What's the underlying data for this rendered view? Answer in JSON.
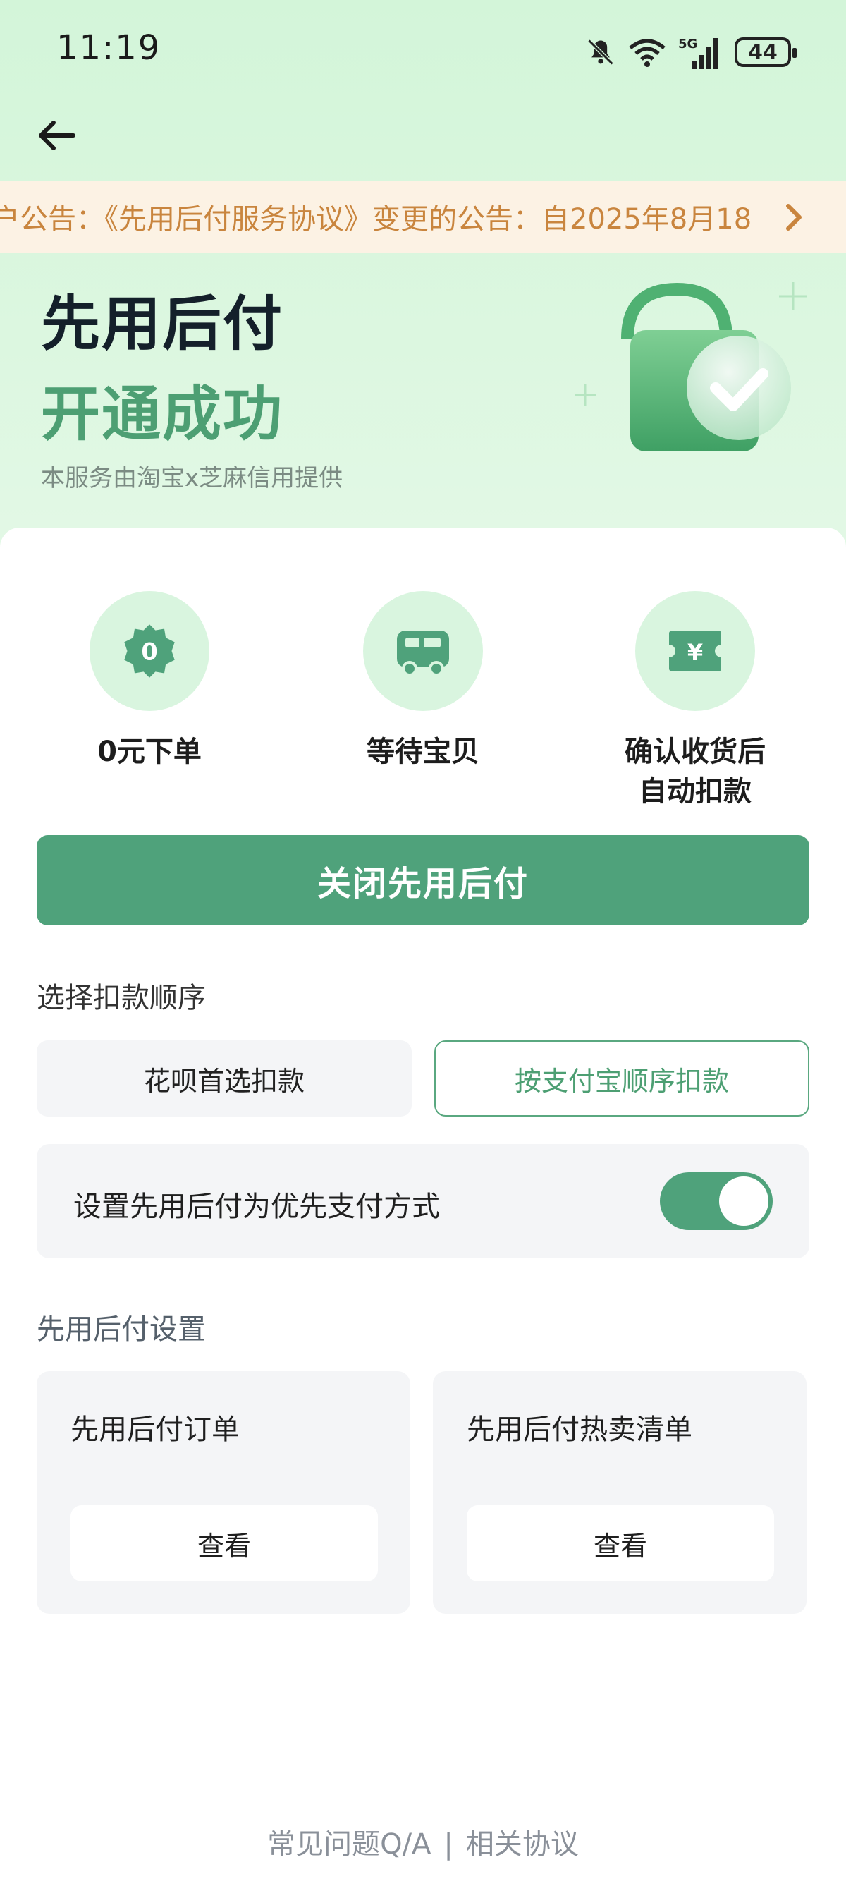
{
  "status_bar": {
    "time": "11:19",
    "network": "5G",
    "battery": "44"
  },
  "notice": {
    "text": "户公告：《先用后付服务协议》变更的公告：自2025年8月18"
  },
  "hero": {
    "title": "先用后付",
    "subtitle": "开通成功",
    "provider": "本服务由淘宝x芝麻信用提供"
  },
  "features": [
    {
      "icon": "zero-badge-icon",
      "badge": "0",
      "label": "0元下单"
    },
    {
      "icon": "truck-icon",
      "label": "等待宝贝"
    },
    {
      "icon": "yen-ticket-icon",
      "badge": "¥",
      "label": "确认收货后\n自动扣款"
    }
  ],
  "close_button": "关闭先用后付",
  "deduction": {
    "label": "选择扣款顺序",
    "options": [
      {
        "label": "花呗首选扣款",
        "selected": false
      },
      {
        "label": "按支付宝顺序扣款",
        "selected": true
      }
    ]
  },
  "preference": {
    "label": "设置先用后付为优先支付方式",
    "enabled": true
  },
  "settings": {
    "label": "先用后付设置",
    "tiles": [
      {
        "title": "先用后付订单",
        "action": "查看"
      },
      {
        "title": "先用后付热卖清单",
        "action": "查看"
      }
    ]
  },
  "footer": {
    "faq": "常见问题Q/A",
    "separator": "|",
    "agreement": "相关协议"
  },
  "colors": {
    "brand_green": "#4fa27b",
    "hero_bg": "#d3f5d9",
    "notice_bg": "#fcf2e4",
    "notice_text": "#c9853e"
  }
}
